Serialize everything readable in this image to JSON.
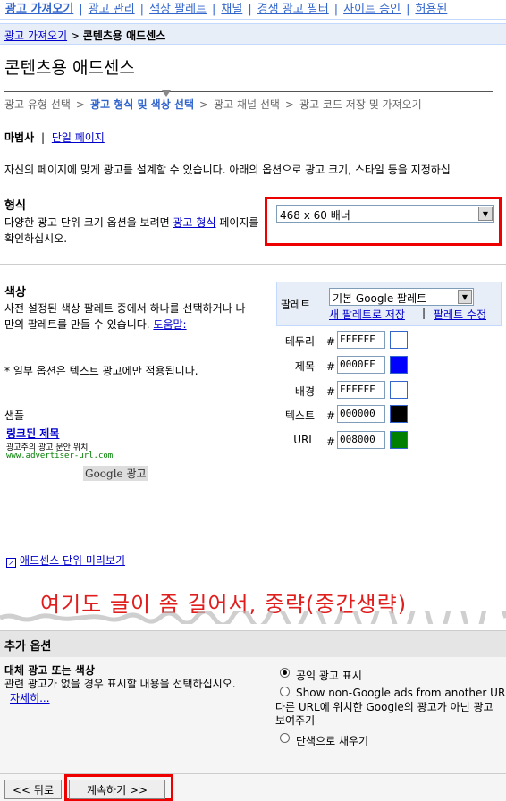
{
  "topnav": {
    "items": [
      "광고 가져오기",
      "광고 관리",
      "색상 팔레트",
      "채널",
      "경쟁 광고 필터",
      "사이트 승인",
      "허용된"
    ]
  },
  "breadcrumb": {
    "parent": "광고 가져오기",
    "separator": ">",
    "current": "콘텐츠용 애드센스"
  },
  "page_title": "콘텐츠용 애드센스",
  "steps": [
    "광고 유형 선택",
    "광고 형식 및 색상 선택",
    "광고 채널 선택",
    "광고 코드 저장 및 가져오기"
  ],
  "steps_current_index": 1,
  "step_arrow": ">",
  "wizard": {
    "active": "마법사",
    "separator": "|",
    "single_page": "단일 페이지"
  },
  "intro": "자신의 페이지에 맞게 광고를 설계할 수 있습니다. 아래의 옵션으로 광고 크기, 스타일 등을 지정하십",
  "format": {
    "title": "형식",
    "desc_before": "다양한 광고 단위 크기 옵션을 보려면",
    "desc_link": "광고 형식",
    "desc_after": "페이지를 확인하십시오.",
    "selected": "468 x 60 배너"
  },
  "colors": {
    "title": "색상",
    "desc": "사전 설정된 색상 팔레트 중에서 하나를 선택하거나 나만의 팔레트를 만들 수 있습니다.",
    "help_link": "도움말:",
    "note": "* 일부 옵션은 텍스트 광고에만 적용됩니다.",
    "palette_label": "팔레트",
    "palette_selected": "기본 Google 팔레트",
    "new_palette": "새 팔레트로 저장",
    "link_sep": "|",
    "edit_palette": "팔레트 수정",
    "hash": "#",
    "rows": [
      {
        "label": "테두리",
        "value": "FFFFFF",
        "swatch": "#FFFFFF"
      },
      {
        "label": "제목",
        "value": "0000FF",
        "swatch": "#0000FF"
      },
      {
        "label": "배경",
        "value": "FFFFFF",
        "swatch": "#FFFFFF"
      },
      {
        "label": "텍스트",
        "value": "000000",
        "swatch": "#000000"
      },
      {
        "label": "URL",
        "value": "008000",
        "swatch": "#008000"
      }
    ]
  },
  "sample": {
    "label": "샘플",
    "ad_title": "링크된 제목",
    "ad_text": "광고주의 광고 문안 위치",
    "ad_url": "www.advertiser-url.com",
    "logo": "Google 광고"
  },
  "preview_link": "애드센스 단위 미리보기",
  "preview_icon": "popup-icon",
  "annotation": "여기도 글이 좀 길어서, 중략(중간생략)",
  "additional": {
    "title": "추가 옵션",
    "alt_title": "대체 광고 또는 색상",
    "alt_desc": "관련 광고가 없을 경우 표시할 내용을 선택하십시오.",
    "more_link": "자세히...",
    "options": [
      {
        "label": "공익 광고 표시",
        "checked": true
      },
      {
        "label": "Show non-Google ads from another URL",
        "checked": false
      },
      {
        "label": "단색으로 채우기",
        "checked": false
      }
    ],
    "option2_desc": "다른 URL에 위치한 Google의 광고가 아닌 광고 보여주기"
  },
  "buttons": {
    "back": "<< 뒤로",
    "next": "계속하기 >>"
  },
  "accent": {
    "annotation_red": "#e01e1e",
    "link_blue": "#0000cc",
    "nav_blue": "#3366cc"
  }
}
